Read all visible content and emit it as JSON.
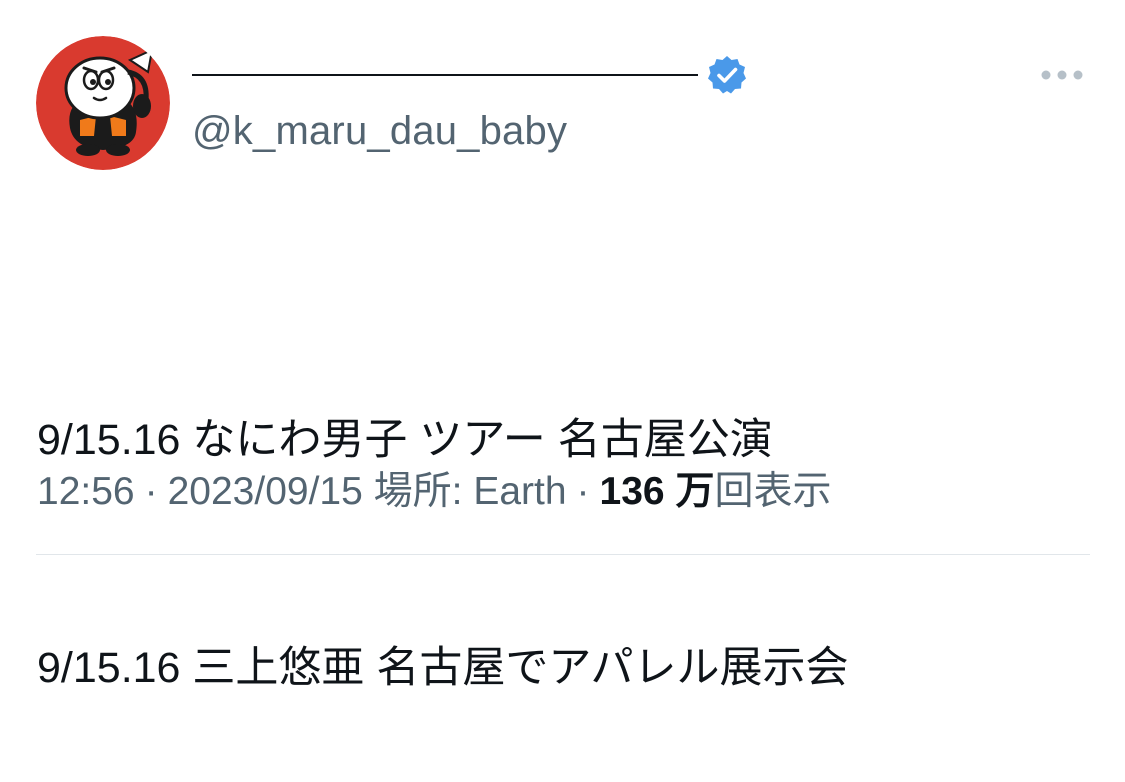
{
  "user": {
    "handle": "@k_maru_dau_baby",
    "verified": true,
    "badge_color": "#4a99e9"
  },
  "menu": {
    "more_icon": "more-horizontal-icon"
  },
  "tweet": {
    "lines": [
      "9/15.16 なにわ男子 ツアー 名古屋公演",
      "9/15.16 三上悠亜 名古屋でアパレル展示会"
    ]
  },
  "meta": {
    "time": "12:56",
    "separator": "·",
    "date": "2023/09/15",
    "location_label": "場所: Earth",
    "views_count": "136 万",
    "views_label": "回表示"
  },
  "colors": {
    "text_primary": "#0f1419",
    "text_secondary": "#536471",
    "avatar_bg": "#d93a2f",
    "divider": "#e1e6ea"
  }
}
